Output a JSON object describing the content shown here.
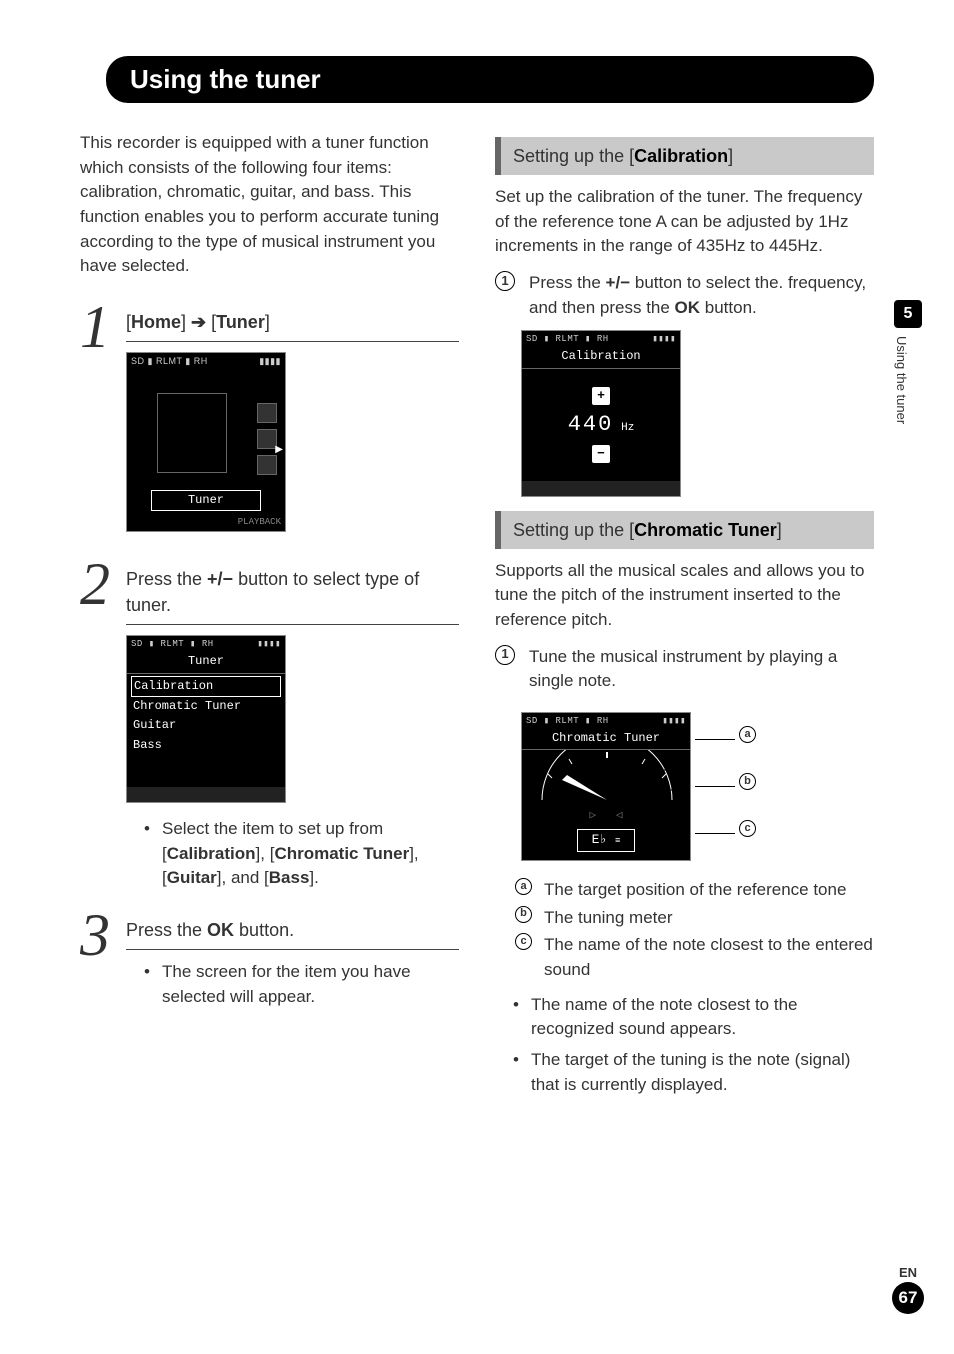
{
  "title": "Using the tuner",
  "intro": "This recorder is equipped with a tuner function which consists of the following four items: calibration, chromatic, guitar, and bass. This function enables you to perform accurate tuning according to the type of musical instrument you have selected.",
  "step1": {
    "home": "Home",
    "arrow": "➔",
    "tuner": "Tuner",
    "screen_label": "Tuner",
    "screen_footer": "PLAYBACK"
  },
  "step2": {
    "text_a": "Press the ",
    "pm": "+/−",
    "text_b": " button to select type of tuner.",
    "screen_title": "Tuner",
    "items": [
      "Calibration",
      "Chromatic Tuner",
      "Guitar",
      "Bass"
    ],
    "bullet_a": "Select the item to set up from [",
    "opt1": "Calibration",
    "sep": "], [",
    "opt2": "Chromatic Tuner",
    "opt3": "Guitar",
    "sep_and": "], and [",
    "opt4": "Bass",
    "bullet_end": "]."
  },
  "step3": {
    "text_a": "Press the ",
    "ok": "OK",
    "text_b": " button.",
    "bullet": "The screen for the item you have selected will appear."
  },
  "calib": {
    "heading_a": "Setting up the [",
    "heading_b": "Calibration",
    "heading_c": "]",
    "desc": "Set up the calibration of the tuner. The frequency of the reference tone A can be adjusted by 1Hz increments in the range of 435Hz to 445Hz.",
    "step_a": "Press the ",
    "pm": "+/−",
    "step_b": " button to select the. frequency, and then press the ",
    "ok": "OK",
    "step_c": " button.",
    "screen_title": "Calibration",
    "value": "440",
    "unit": "Hz"
  },
  "chrom": {
    "heading_a": "Setting up the [",
    "heading_b": "Chromatic Tuner",
    "heading_c": "]",
    "desc": "Supports all the musical scales and allows you to tune the pitch of the instrument inserted to the reference pitch.",
    "step": "Tune the musical instrument by playing a single note.",
    "screen_title": "Chromatic Tuner",
    "note": "E♭",
    "a": "a",
    "b": "b",
    "c": "c",
    "ann_a": "The target position of the reference tone",
    "ann_b": "The tuning meter",
    "ann_c": "The name of the note closest to the entered sound",
    "bul1": "The name of the note closest to the recognized sound appears.",
    "bul2": "The target of the tuning is the note (signal) that is currently displayed."
  },
  "side": {
    "num": "5",
    "text": "Using the tuner"
  },
  "footer": {
    "lang": "EN",
    "page": "67"
  },
  "status_icons": "SD ▮ RLMT ▮ RH"
}
